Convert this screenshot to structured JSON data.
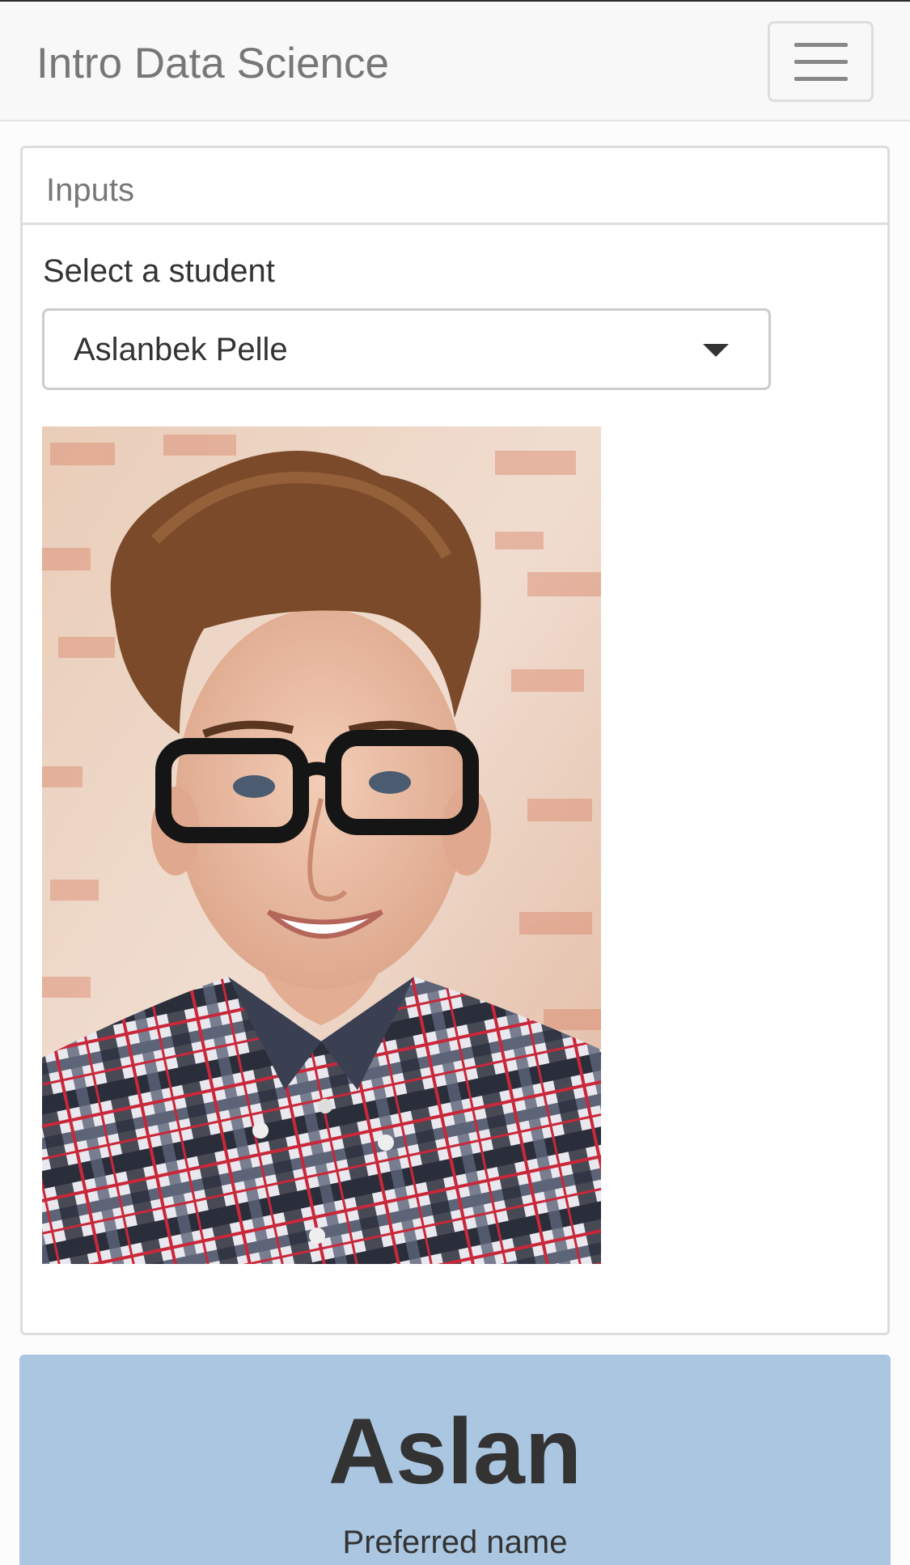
{
  "navbar": {
    "brand": "Intro Data Science",
    "menu_icon": "hamburger-menu-icon"
  },
  "panel": {
    "heading": "Inputs",
    "select_label": "Select a student",
    "selected_student": "Aslanbek Pelle",
    "dropdown_icon": "caret-down-icon"
  },
  "photo": {
    "description_icon": "student-photo"
  },
  "profile": {
    "preferred_name": "Aslan",
    "preferred_name_label": "Preferred name"
  },
  "colors": {
    "navbar_bg": "#f8f8f8",
    "info_bg": "#aac6e0",
    "border": "#dddddd",
    "brand_text": "#777777"
  }
}
